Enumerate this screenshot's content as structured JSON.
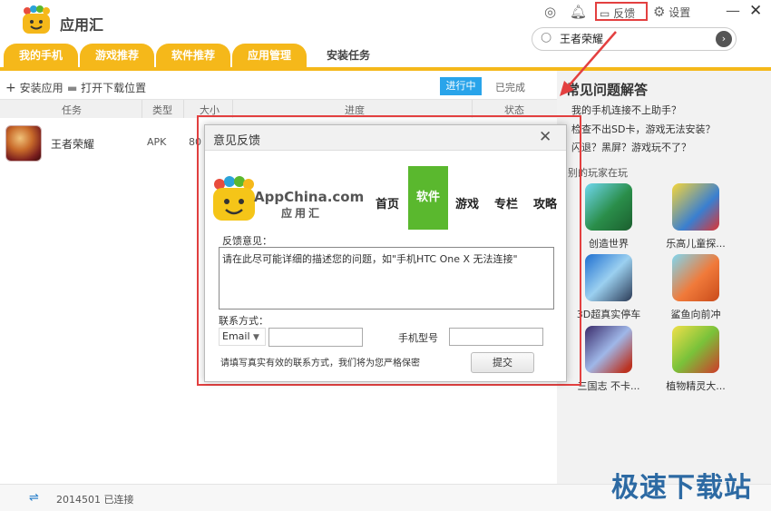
{
  "app": {
    "title": "应用汇"
  },
  "header": {
    "feedback_label": "反馈",
    "settings_label": "设置",
    "search_value": "王者荣耀"
  },
  "tabs": [
    {
      "label": "我的手机"
    },
    {
      "label": "游戏推荐"
    },
    {
      "label": "软件推荐"
    },
    {
      "label": "应用管理"
    },
    {
      "label": "安装任务"
    }
  ],
  "toolbar": {
    "install_label": "安装应用",
    "open_download_label": "打开下载位置",
    "status_running": "进行中",
    "status_done": "已完成"
  },
  "table": {
    "headers": [
      "任务",
      "类型",
      "大小",
      "进度",
      "状态"
    ],
    "rows": [
      {
        "name": "王者荣耀",
        "type": "APK",
        "size": "80"
      }
    ]
  },
  "sidebar": {
    "faq_title": "常见问题解答",
    "faq": [
      "我的手机连接不上助手？",
      "检查不出SD卡，游戏无法安装？",
      "闪退？黑屏？游戏玩不了？"
    ],
    "others_title": "别的玩家在玩",
    "apps": [
      {
        "name": "创造世界"
      },
      {
        "name": "乐高儿童探..."
      },
      {
        "name": "3D超真实停车"
      },
      {
        "name": "鲨鱼向前冲"
      },
      {
        "name": "三国志 不卡..."
      },
      {
        "name": "植物精灵大..."
      }
    ]
  },
  "statusbar": {
    "device": "2014501 已连接"
  },
  "watermark": "极速下载站",
  "dialog": {
    "title": "意见反馈",
    "brand": "AppChina.com",
    "brand_sub": "应用汇",
    "nav": [
      "首页",
      "软件",
      "游戏",
      "专栏",
      "攻略"
    ],
    "feedback_label": "反馈意见：",
    "feedback_text": "请在此尽可能详细的描述您的问题，如\"手机HTC One X 无法连接\"",
    "contact_label": "联系方式：",
    "contact_type": "Email",
    "model_label": "手机型号",
    "notice": "请填写真实有效的联系方式，我们将为您严格保密",
    "submit_label": "提交"
  },
  "colors": {
    "tab": "#f5b81a",
    "accent_blue": "#29a4ea",
    "highlight_red": "#e34040",
    "nav_green": "#5ab82e"
  }
}
